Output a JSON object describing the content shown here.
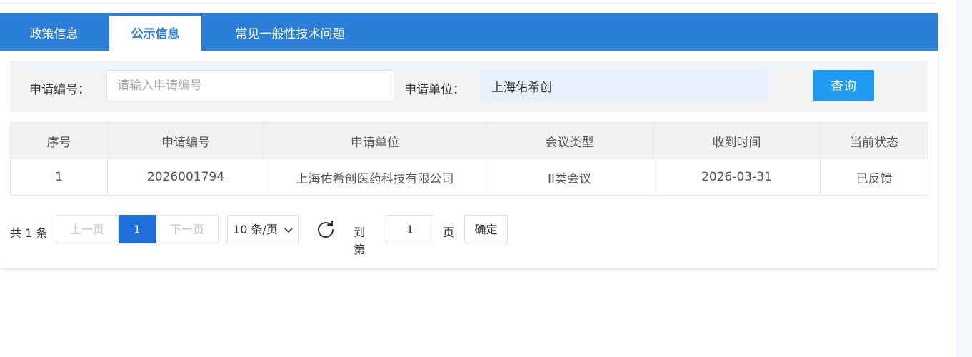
{
  "tabs": [
    {
      "label": "政策信息",
      "active": false
    },
    {
      "label": "公示信息",
      "active": true
    },
    {
      "label": "常见一般性技术问题",
      "active": false
    }
  ],
  "search": {
    "app_no_label": "申请编号：",
    "app_no_placeholder": "请输入申请编号",
    "app_no_value": "",
    "unit_label": "申请单位：",
    "unit_value": "上海佑希创",
    "query_label": "查询"
  },
  "table": {
    "headers": [
      "序号",
      "申请编号",
      "申请单位",
      "会议类型",
      "收到时间",
      "当前状态"
    ],
    "rows": [
      [
        "1",
        "2026001794",
        "上海佑希创医药科技有限公司",
        "II类会议",
        "2026-03-31",
        "已反馈"
      ]
    ]
  },
  "pagination": {
    "total_text": "共 1 条",
    "prev_label": "上一页",
    "current_page": "1",
    "next_label": "下一页",
    "page_size_label": "10 条/页",
    "goto_label": "到第",
    "goto_value": "1",
    "page_unit": "页",
    "confirm_label": "确定"
  },
  "colors": {
    "tab_bar": "#2b7fd8",
    "primary_button": "#1e9bf0",
    "current_page": "#1e6fd9"
  }
}
